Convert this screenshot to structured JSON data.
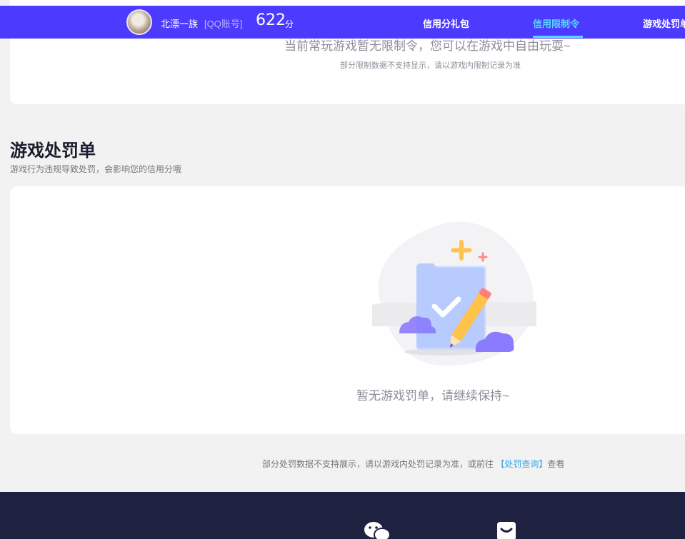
{
  "header": {
    "username": "北漂一族",
    "account_type": "[QQ账号]",
    "score": "622",
    "score_unit": "分",
    "nav": [
      {
        "label": "信用分礼包",
        "active": false
      },
      {
        "label": "信用限制令",
        "active": true
      },
      {
        "label": "游戏处罚单",
        "active": false
      }
    ],
    "colors": {
      "bar": "#4c3bff",
      "active": "#57d7ff"
    }
  },
  "restriction_card": {
    "message": "当前常玩游戏暂无限制令，您可以在游戏中自由玩耍~",
    "note": "部分限制数据不支持显示，请以游戏内限制记录为准"
  },
  "penalty_section": {
    "title": "游戏处罚单",
    "subtitle": "游戏行为违规导致处罚，会影响您的信用分哦",
    "empty_message": "暂无游戏罚单，请继续保持~",
    "footnote_prefix": "部分处罚数据不支持展示，请以游戏内处罚记录为准，或前往",
    "footnote_link": "【处罚查询】",
    "footnote_suffix": "查看"
  },
  "footer": {
    "icons": [
      "wechat-icon",
      "chat-bubble-icon"
    ]
  }
}
